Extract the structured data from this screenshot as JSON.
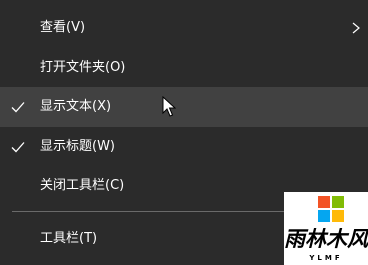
{
  "menu": {
    "items": [
      {
        "label": "查看(V)",
        "checked": false,
        "submenu": true,
        "hover": false
      },
      {
        "label": "打开文件夹(O)",
        "checked": false,
        "submenu": false,
        "hover": false
      },
      {
        "label": "显示文本(X)",
        "checked": true,
        "submenu": false,
        "hover": true
      },
      {
        "label": "显示标题(W)",
        "checked": true,
        "submenu": false,
        "hover": false
      },
      {
        "label": "关闭工具栏(C)",
        "checked": false,
        "submenu": false,
        "hover": false
      },
      {
        "label": "工具栏(T)",
        "checked": false,
        "submenu": false,
        "hover": false
      }
    ]
  },
  "icons": {
    "check": "checkmark-icon",
    "submenu": "chevron-right-icon",
    "cursor": "mouse-pointer-icon",
    "logo": "windows-logo-icon"
  },
  "watermark": {
    "text": "雨林木风",
    "subtext": "YLMF"
  },
  "colors": {
    "menu_bg": "#2b2b2b",
    "hover_bg": "#414141",
    "separator": "#6a6a6a",
    "text": "#ffffff",
    "logo_red": "#f35325",
    "logo_green": "#81bc06",
    "logo_blue": "#05a6f0",
    "logo_yellow": "#ffba08"
  }
}
